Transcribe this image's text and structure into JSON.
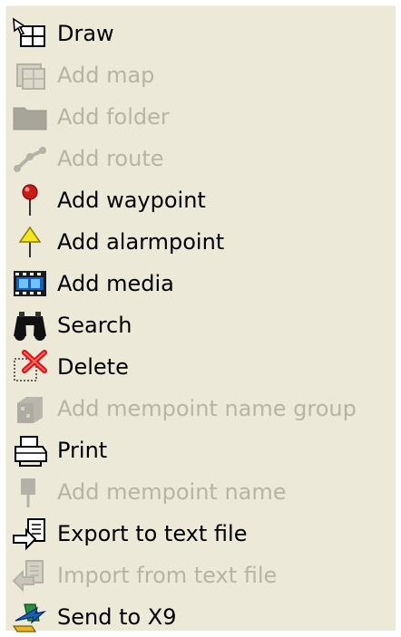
{
  "menu": {
    "items": [
      {
        "label": "Draw",
        "enabled": true,
        "icon": "draw-icon"
      },
      {
        "label": "Add map",
        "enabled": false,
        "icon": "map-icon"
      },
      {
        "label": "Add folder",
        "enabled": false,
        "icon": "folder-icon"
      },
      {
        "label": "Add route",
        "enabled": false,
        "icon": "route-icon"
      },
      {
        "label": "Add waypoint",
        "enabled": true,
        "icon": "waypoint-pin-icon"
      },
      {
        "label": "Add alarmpoint",
        "enabled": true,
        "icon": "alarmpoint-icon"
      },
      {
        "label": "Add media",
        "enabled": true,
        "icon": "film-icon"
      },
      {
        "label": "Search",
        "enabled": true,
        "icon": "binoculars-icon"
      },
      {
        "label": "Delete",
        "enabled": true,
        "icon": "delete-x-icon"
      },
      {
        "label": "Add mempoint name group",
        "enabled": false,
        "icon": "name-group-icon"
      },
      {
        "label": "Print",
        "enabled": true,
        "icon": "printer-icon"
      },
      {
        "label": "Add mempoint name",
        "enabled": false,
        "icon": "mempoint-name-icon"
      },
      {
        "label": "Export to text file",
        "enabled": true,
        "icon": "export-icon"
      },
      {
        "label": "Import from text file",
        "enabled": false,
        "icon": "import-icon"
      },
      {
        "label": "Send to X9",
        "enabled": true,
        "icon": "send-device-icon"
      }
    ]
  },
  "colors": {
    "menu_background": "#ece9d8",
    "enabled_text": "#000000",
    "disabled_text": "#b7b4a6",
    "waypoint_red": "#cc1a1a",
    "alarm_yellow": "#f5e71c",
    "delete_red": "#e01010",
    "media_blue": "#1a5fb4"
  }
}
